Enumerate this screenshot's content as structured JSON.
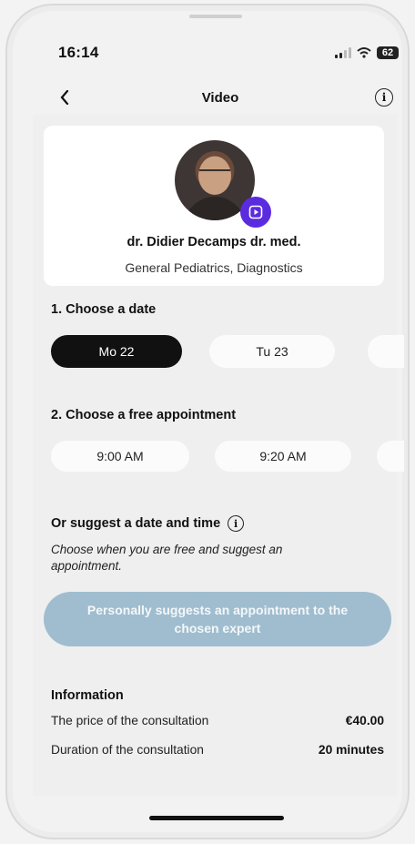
{
  "status": {
    "time": "16:14",
    "battery": "62"
  },
  "nav": {
    "title": "Video"
  },
  "doctor": {
    "name": "dr.  Didier Decamps dr. med.",
    "specialty": "General Pediatrics, Diagnostics"
  },
  "date_section": {
    "heading": "1. Choose a date",
    "dates": [
      "Mo 22",
      "Tu 23"
    ],
    "selected": "Mo 22"
  },
  "time_section": {
    "heading": "2. Choose a free appointment",
    "times": [
      "9:00 AM",
      "9:20 AM"
    ]
  },
  "suggest": {
    "heading": "Or suggest a date and time",
    "description": "Choose when you are free and suggest an appointment.",
    "button_label": "Personally suggests an appointment to the chosen expert"
  },
  "information": {
    "heading": "Information",
    "price_label": "The price of the consultation",
    "price_value": "€40.00",
    "duration_label": "Duration of the consultation",
    "duration_value": "20 minutes"
  },
  "colors": {
    "selected_pill": "#111111",
    "video_badge": "#5b2be0",
    "suggest_button": "#9fbdcf"
  },
  "icons": {
    "back": "chevron-left-icon",
    "info": "info-circle-icon",
    "video": "video-play-icon"
  }
}
